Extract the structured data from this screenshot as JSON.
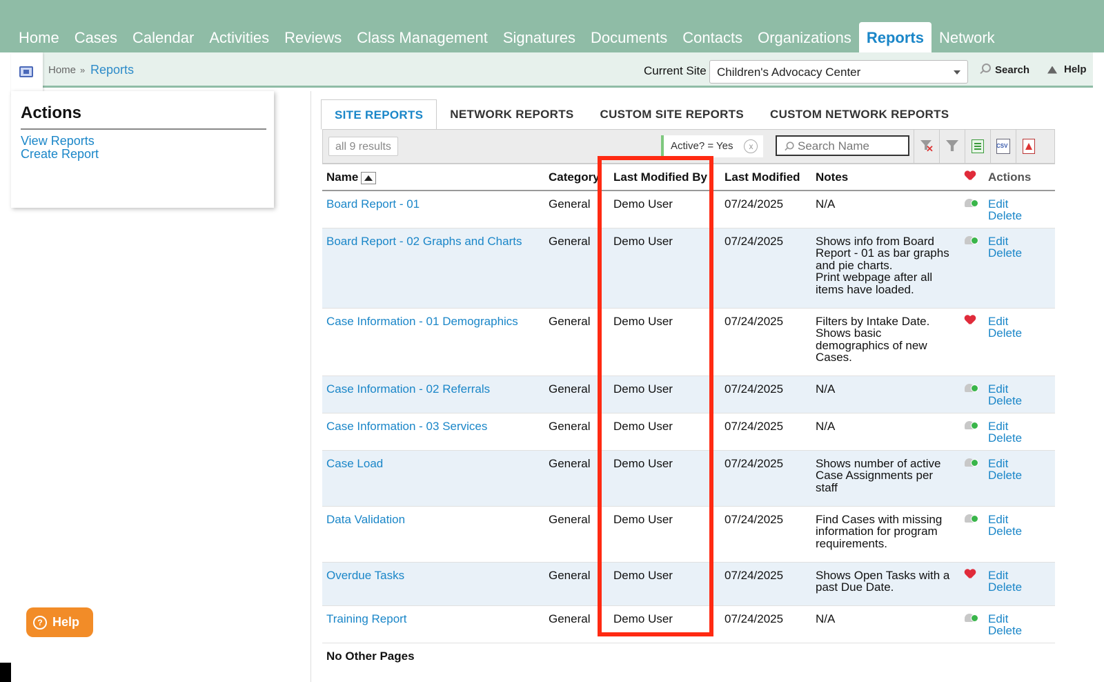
{
  "nav": {
    "items": [
      "Home",
      "Cases",
      "Calendar",
      "Activities",
      "Reviews",
      "Class Management",
      "Signatures",
      "Documents",
      "Contacts",
      "Organizations",
      "Reports",
      "Network"
    ],
    "active": "Reports"
  },
  "breadcrumb": {
    "home": "Home",
    "sep": "»",
    "current": "Reports"
  },
  "site": {
    "label": "Current Site",
    "selected": "Children's Advocacy Center"
  },
  "topbar": {
    "search_label": "Search",
    "help_label": "Help"
  },
  "actions": {
    "title": "Actions",
    "links": [
      "View Reports",
      "Create Report"
    ]
  },
  "tabs": [
    "SITE REPORTS",
    "NETWORK REPORTS",
    "CUSTOM SITE REPORTS",
    "CUSTOM NETWORK REPORTS"
  ],
  "toolbar": {
    "results": "all 9 results",
    "filter": "Active? = Yes",
    "filter_clear": "x",
    "search_placeholder": "Search Name"
  },
  "table": {
    "headers": {
      "name": "Name",
      "category": "Category",
      "modified_by": "Last Modified By",
      "modified": "Last Modified",
      "notes": "Notes",
      "actions": "Actions"
    },
    "rows": [
      {
        "name": "Board Report - 01",
        "category": "General",
        "modified_by": "Demo User",
        "modified": "07/24/2025",
        "notes": [
          "N/A"
        ],
        "favorite": false
      },
      {
        "name": "Board Report - 02 Graphs and Charts",
        "category": "General",
        "modified_by": "Demo User",
        "modified": "07/24/2025",
        "notes": [
          "Shows info from Board",
          "Report - 01 as bar graphs",
          "and pie charts.",
          "Print webpage after all",
          "items have loaded."
        ],
        "favorite": false
      },
      {
        "name": "Case Information - 01 Demographics",
        "category": "General",
        "modified_by": "Demo User",
        "modified": "07/24/2025",
        "notes": [
          "Filters by Intake Date.",
          "Shows basic",
          "demographics of new",
          "Cases."
        ],
        "favorite": true
      },
      {
        "name": "Case Information - 02 Referrals",
        "category": "General",
        "modified_by": "Demo User",
        "modified": "07/24/2025",
        "notes": [
          "N/A"
        ],
        "favorite": false
      },
      {
        "name": "Case Information - 03 Services",
        "category": "General",
        "modified_by": "Demo User",
        "modified": "07/24/2025",
        "notes": [
          "N/A"
        ],
        "favorite": false
      },
      {
        "name": "Case Load",
        "category": "General",
        "modified_by": "Demo User",
        "modified": "07/24/2025",
        "notes": [
          "Shows number of active",
          "Case Assignments per",
          "staff"
        ],
        "favorite": false
      },
      {
        "name": "Data Validation",
        "category": "General",
        "modified_by": "Demo User",
        "modified": "07/24/2025",
        "notes": [
          "Find Cases with missing",
          "information for program",
          "requirements."
        ],
        "favorite": false
      },
      {
        "name": "Overdue Tasks",
        "category": "General",
        "modified_by": "Demo User",
        "modified": "07/24/2025",
        "notes": [
          "Shows Open Tasks with a",
          "past Due Date."
        ],
        "favorite": true
      },
      {
        "name": "Training Report",
        "category": "General",
        "modified_by": "Demo User",
        "modified": "07/24/2025",
        "notes": [
          "N/A"
        ],
        "favorite": false
      }
    ],
    "edit_label": "Edit",
    "delete_label": "Delete",
    "footer": "No Other Pages"
  },
  "help_button": "Help",
  "colors": {
    "nav_bg": "#8fbca6",
    "link": "#1a86c8",
    "highlight": "#ff2a12",
    "help_orange": "#f28c28",
    "alt_row": "#e9f1f8"
  }
}
